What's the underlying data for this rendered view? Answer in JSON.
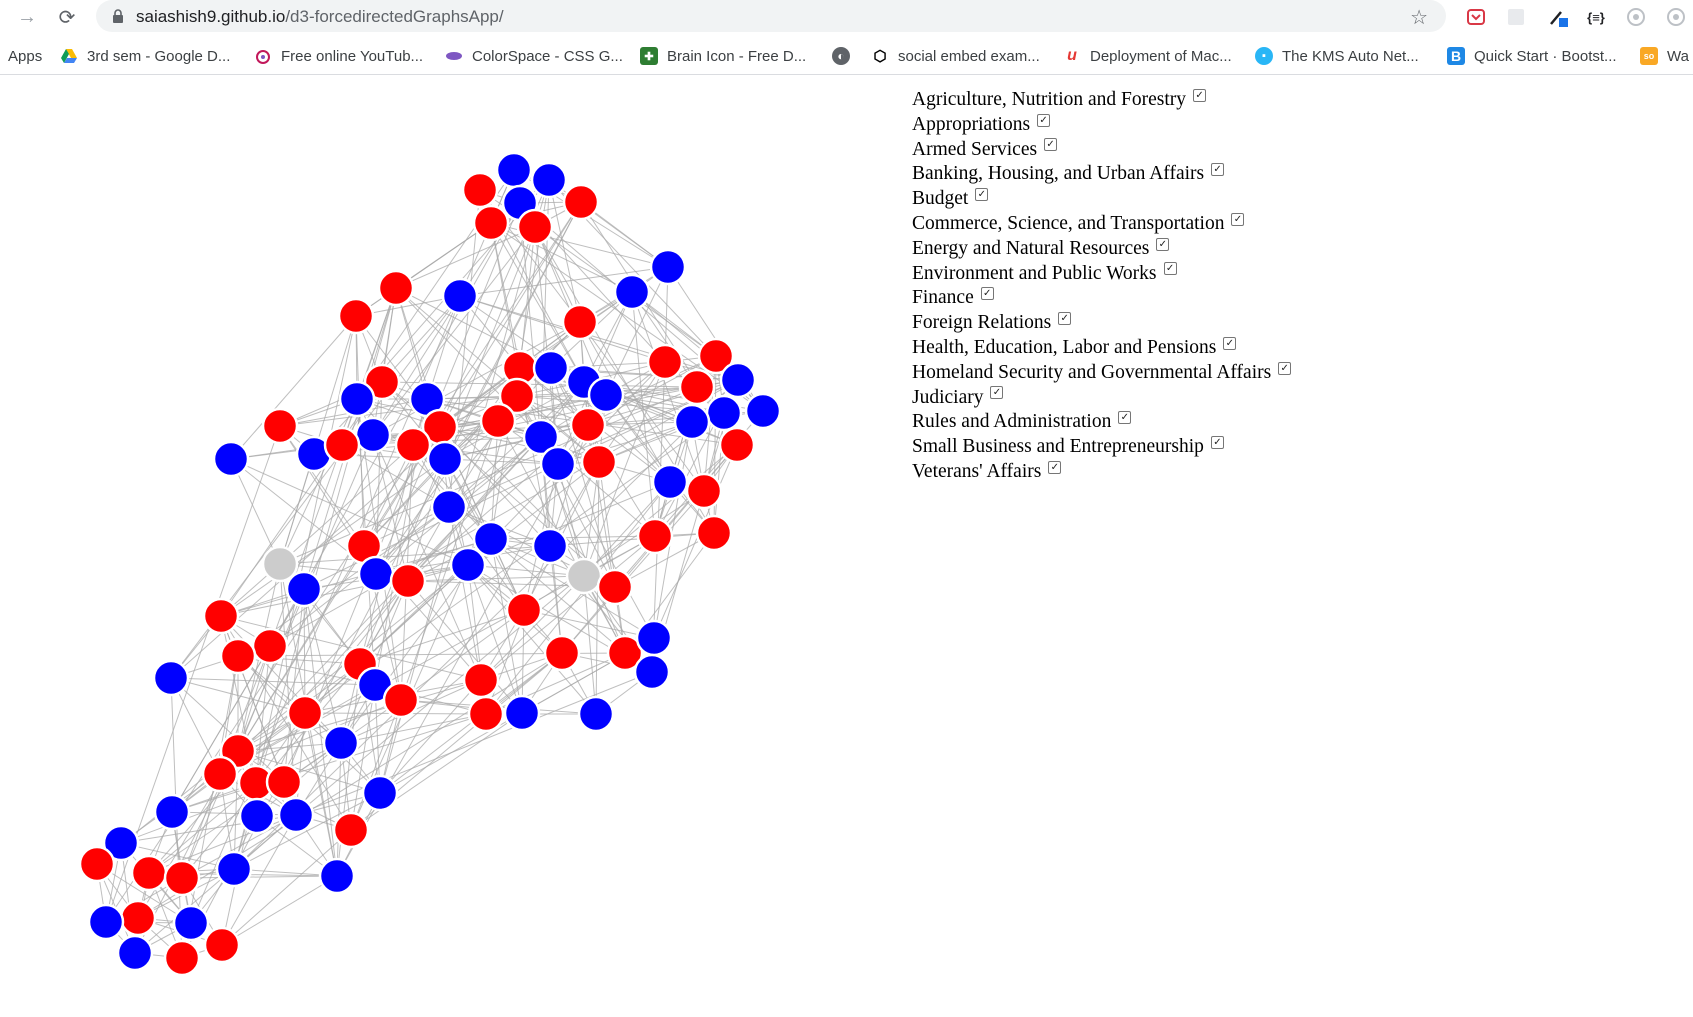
{
  "browser": {
    "url_host": "saiashish9.github.io",
    "url_path": "/d3-forcedirectedGraphsApp/"
  },
  "bookmarks": [
    {
      "label": "Apps",
      "icon": "apps-icon"
    },
    {
      "label": "3rd sem - Google D...",
      "icon": "google-drive-icon"
    },
    {
      "label": "Free online YouTub...",
      "icon": "youtube-tool-icon"
    },
    {
      "label": "ColorSpace - CSS G...",
      "icon": "colorspace-icon"
    },
    {
      "label": "Brain Icon - Free D...",
      "icon": "brain-icon"
    },
    {
      "label": "",
      "icon": "globe-icon"
    },
    {
      "label": "social embed exam...",
      "icon": "codepen-icon"
    },
    {
      "label": "Deployment of Mac...",
      "icon": "deployment-icon"
    },
    {
      "label": "The KMS Auto Net...",
      "icon": "windows-icon"
    },
    {
      "label": "Quick Start · Bootst...",
      "icon": "bootstrap-icon"
    },
    {
      "label": "Wa",
      "icon": "wa-icon"
    }
  ],
  "legend": {
    "committees": [
      {
        "label": "Agriculture, Nutrition and Forestry",
        "checked": true
      },
      {
        "label": "Appropriations",
        "checked": true
      },
      {
        "label": "Armed Services",
        "checked": true
      },
      {
        "label": "Banking, Housing, and Urban Affairs",
        "checked": true
      },
      {
        "label": "Budget",
        "checked": true
      },
      {
        "label": "Commerce, Science, and Transportation",
        "checked": true
      },
      {
        "label": "Energy and Natural Resources",
        "checked": true
      },
      {
        "label": "Environment and Public Works",
        "checked": true
      },
      {
        "label": "Finance",
        "checked": true
      },
      {
        "label": "Foreign Relations",
        "checked": true
      },
      {
        "label": "Health, Education, Labor and Pensions",
        "checked": true
      },
      {
        "label": "Homeland Security and Governmental Affairs",
        "checked": true
      },
      {
        "label": "Judiciary",
        "checked": true
      },
      {
        "label": "Rules and Administration",
        "checked": true
      },
      {
        "label": "Small Business and Entrepreneurship",
        "checked": true
      },
      {
        "label": "Veterans' Affairs",
        "checked": true
      }
    ]
  },
  "graph": {
    "colors": {
      "red": "#ff0000",
      "blue": "#0000ff",
      "gray": "#cccccc",
      "link": "#aaaaaa"
    },
    "red_count": 56,
    "blue_count": 49,
    "gray_count": 2
  }
}
